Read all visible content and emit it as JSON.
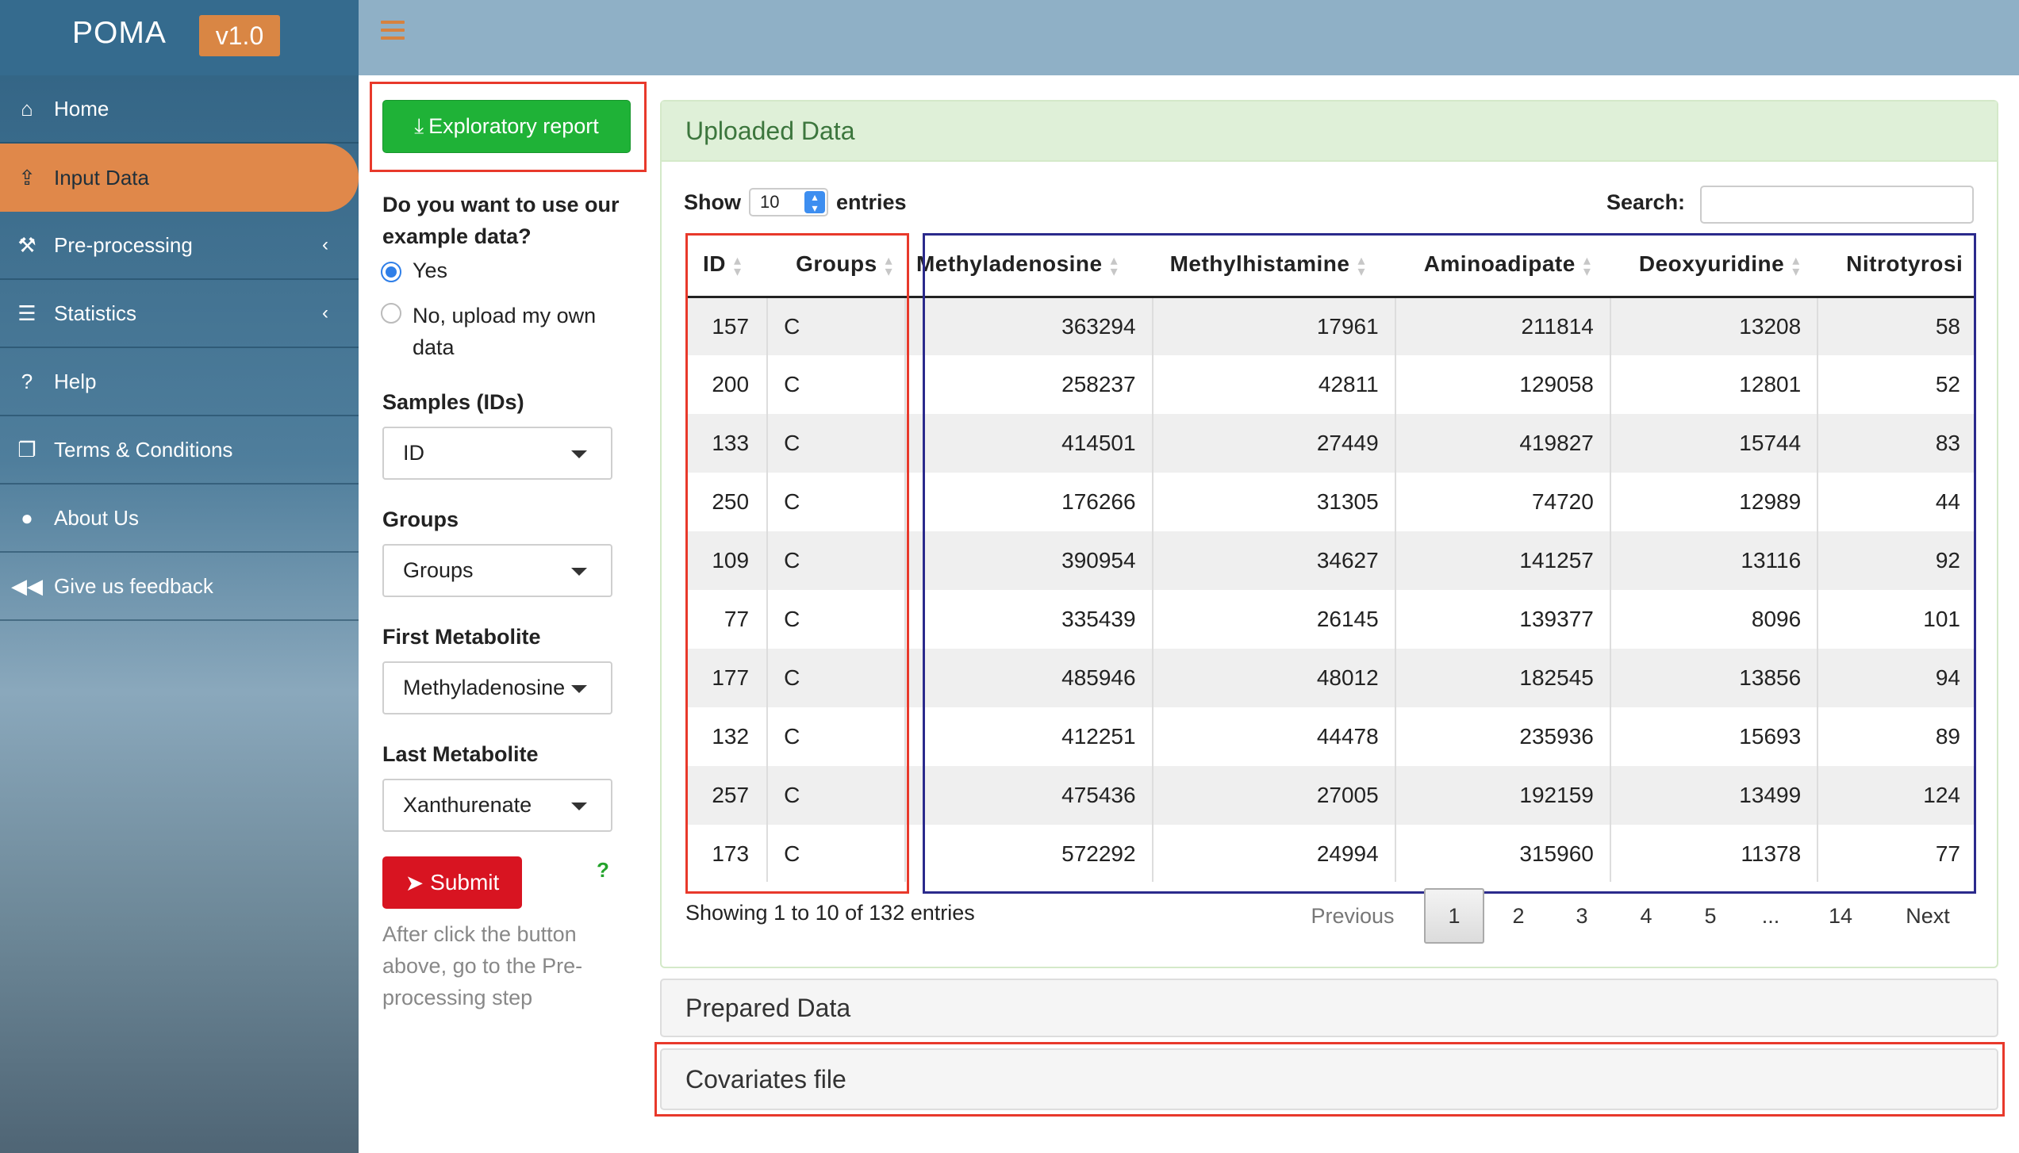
{
  "app": {
    "name": "POMA",
    "version": "v1.0"
  },
  "sidebar": {
    "items": [
      {
        "label": "Home",
        "icon": "home-icon"
      },
      {
        "label": "Input Data",
        "icon": "upload-icon",
        "active": true
      },
      {
        "label": "Pre-processing",
        "icon": "wrench-icon",
        "chevron": "‹"
      },
      {
        "label": "Statistics",
        "icon": "sliders-icon",
        "chevron": "‹"
      },
      {
        "label": "Help",
        "icon": "question-icon"
      },
      {
        "label": "Terms & Conditions",
        "icon": "copy-icon"
      },
      {
        "label": "About Us",
        "icon": "user-icon"
      },
      {
        "label": "Give us feedback",
        "icon": "backward-icon"
      }
    ]
  },
  "controls": {
    "report_button": "Exploratory report",
    "example_question": "Do you want to use our example data?",
    "radio_yes": "Yes",
    "radio_no": "No, upload my own data",
    "samples_label": "Samples (IDs)",
    "samples_value": "ID",
    "groups_label": "Groups",
    "groups_value": "Groups",
    "first_label": "First Metabolite",
    "first_value": "Methyladenosine",
    "last_label": "Last Metabolite",
    "last_value": "Xanthurenate",
    "submit": "Submit",
    "help_mark": "?",
    "hint": "After click the button above, go to the Pre-processing step"
  },
  "uploaded": {
    "title": "Uploaded Data",
    "show_label": "Show",
    "page_length": "10",
    "entries_label": "entries",
    "search_label": "Search:",
    "columns": [
      "ID",
      "Groups",
      "Methyladenosine",
      "Methylhistamine",
      "Aminoadipate",
      "Deoxyuridine",
      "Nitrotyrosi"
    ],
    "rows": [
      [
        "157",
        "C",
        "363294",
        "17961",
        "211814",
        "13208",
        "58"
      ],
      [
        "200",
        "C",
        "258237",
        "42811",
        "129058",
        "12801",
        "52"
      ],
      [
        "133",
        "C",
        "414501",
        "27449",
        "419827",
        "15744",
        "83"
      ],
      [
        "250",
        "C",
        "176266",
        "31305",
        "74720",
        "12989",
        "44"
      ],
      [
        "109",
        "C",
        "390954",
        "34627",
        "141257",
        "13116",
        "92"
      ],
      [
        "77",
        "C",
        "335439",
        "26145",
        "139377",
        "8096",
        "101"
      ],
      [
        "177",
        "C",
        "485946",
        "48012",
        "182545",
        "13856",
        "94"
      ],
      [
        "132",
        "C",
        "412251",
        "44478",
        "235936",
        "15693",
        "89"
      ],
      [
        "257",
        "C",
        "475436",
        "27005",
        "192159",
        "13499",
        "124"
      ],
      [
        "173",
        "C",
        "572292",
        "24994",
        "315960",
        "11378",
        "77"
      ]
    ],
    "info": "Showing 1 to 10 of 132 entries",
    "pagination": {
      "previous": "Previous",
      "pages": [
        "1",
        "2",
        "3",
        "4",
        "5",
        "...",
        "14"
      ],
      "next": "Next",
      "current": "1"
    }
  },
  "sections": {
    "prepared": "Prepared Data",
    "covariates": "Covariates file"
  },
  "colors": {
    "sidebar_active": "#e0884a",
    "header": "#8fb0c6",
    "report_button": "#1fb237",
    "submit_button": "#d81421",
    "highlight_red": "#e8392b",
    "highlight_blue": "#2b2a8c",
    "box_header": "#dff0d8"
  }
}
